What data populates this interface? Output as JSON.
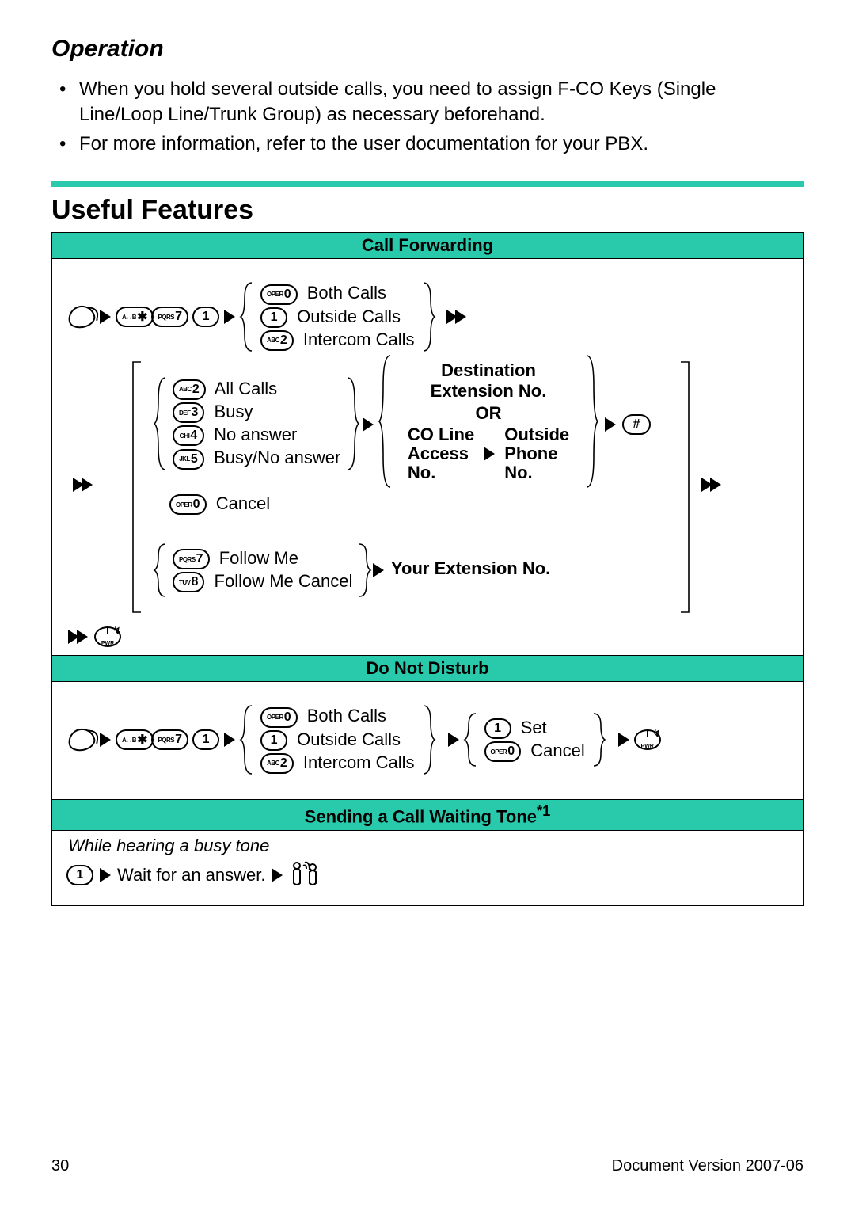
{
  "header": {
    "title": "Operation"
  },
  "bullets": [
    "When you hold several outside calls, you need to assign F-CO Keys (Single Line/Loop Line/Trunk Group) as necessary beforehand.",
    "For more information, refer to the user documentation for your PBX."
  ],
  "section_title": "Useful Features",
  "features": {
    "call_forwarding": {
      "header": "Call Forwarding",
      "seq_keys": [
        {
          "prefix": "A↔B",
          "digit": "✱"
        },
        {
          "prefix": "PQRS",
          "digit": "7"
        },
        {
          "prefix": "",
          "digit": "1"
        }
      ],
      "call_types": [
        {
          "prefix": "OPER",
          "digit": "0",
          "label": "Both Calls"
        },
        {
          "prefix": "",
          "digit": "1",
          "label": "Outside Calls"
        },
        {
          "prefix": "ABC",
          "digit": "2",
          "label": "Intercom Calls"
        }
      ],
      "conditions": [
        {
          "prefix": "ABC",
          "digit": "2",
          "label": "All Calls"
        },
        {
          "prefix": "DEF",
          "digit": "3",
          "label": "Busy"
        },
        {
          "prefix": "GHI",
          "digit": "4",
          "label": "No answer"
        },
        {
          "prefix": "JKL",
          "digit": "5",
          "label": "Busy/No answer"
        }
      ],
      "cancel": {
        "prefix": "OPER",
        "digit": "0",
        "label": "Cancel"
      },
      "follow": [
        {
          "prefix": "PQRS",
          "digit": "7",
          "label": "Follow Me"
        },
        {
          "prefix": "TUV",
          "digit": "8",
          "label": "Follow Me Cancel"
        }
      ],
      "dest_title": "Destination\nExtension No.",
      "or_label": "OR",
      "co_label": "CO Line\nAccess\nNo.",
      "outside_label": "Outside\nPhone\nNo.",
      "your_ext": "Your Extension No.",
      "hash": "#",
      "pwr": "PWR"
    },
    "dnd": {
      "header": "Do Not Disturb",
      "seq_keys": [
        {
          "prefix": "A↔B",
          "digit": "✱"
        },
        {
          "prefix": "PQRS",
          "digit": "7"
        },
        {
          "prefix": "",
          "digit": "1"
        }
      ],
      "call_types": [
        {
          "prefix": "OPER",
          "digit": "0",
          "label": "Both Calls"
        },
        {
          "prefix": "",
          "digit": "1",
          "label": "Outside Calls"
        },
        {
          "prefix": "ABC",
          "digit": "2",
          "label": "Intercom Calls"
        }
      ],
      "actions": [
        {
          "prefix": "",
          "digit": "1",
          "label": "Set"
        },
        {
          "prefix": "OPER",
          "digit": "0",
          "label": "Cancel"
        }
      ],
      "pwr": "PWR"
    },
    "call_waiting": {
      "header": "Sending a Call Waiting Tone",
      "header_sup": "*1",
      "note": "While hearing a busy tone",
      "key": {
        "prefix": "",
        "digit": "1"
      },
      "wait_text": "Wait for an answer."
    }
  },
  "footer": {
    "page": "30",
    "version": "Document Version 2007-06"
  },
  "icons": {
    "talk": "talk-icon",
    "pwr": "pwr-icon",
    "people": "people-icon"
  }
}
